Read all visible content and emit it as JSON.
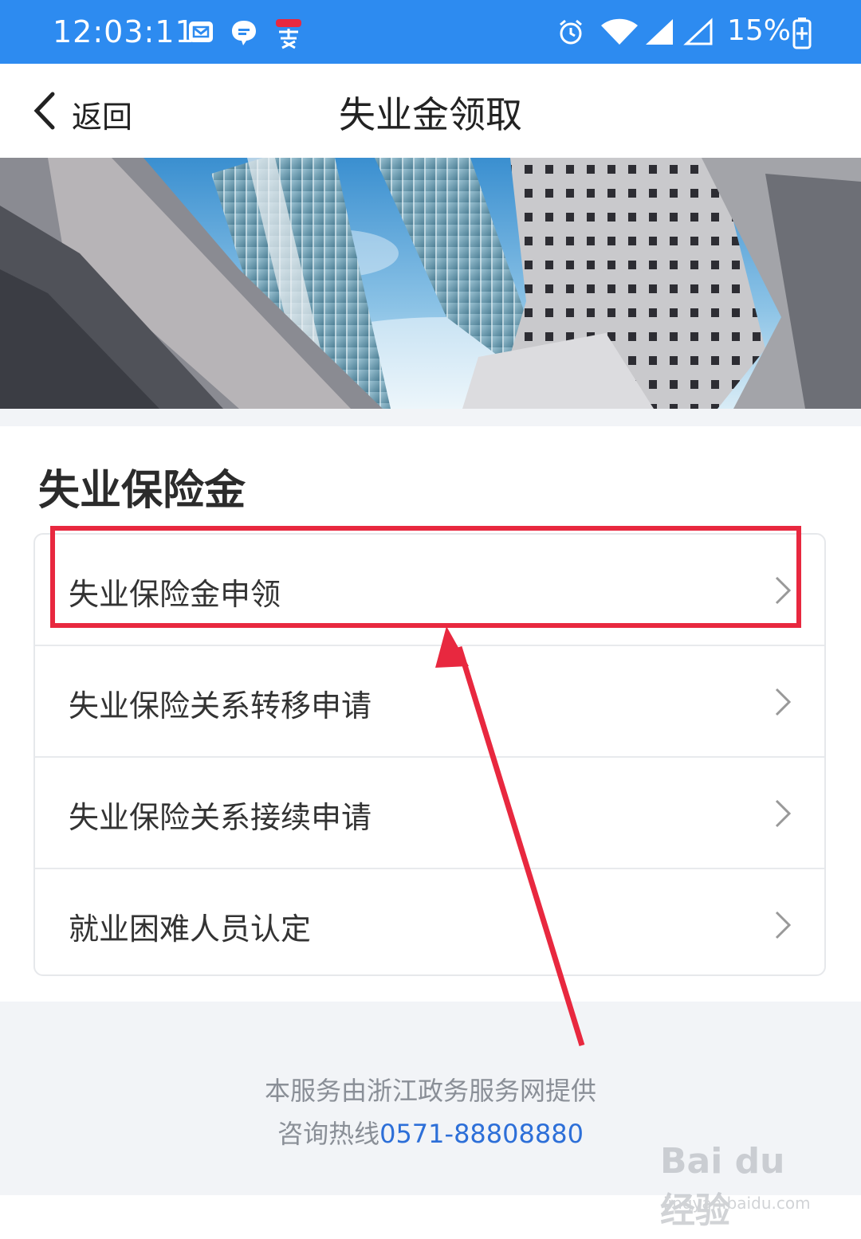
{
  "status_bar": {
    "time": "12:03:11",
    "battery": "15%",
    "left_icons": [
      "mail-icon",
      "chat-bubble-icon",
      "app-badge-icon"
    ],
    "right_icons": [
      "alarm-icon",
      "wifi-icon",
      "signal-icon",
      "signal-empty-icon",
      "battery-charging-icon"
    ],
    "background_color": "#2d8bf0"
  },
  "nav": {
    "back_label": "返回",
    "title": "失业金领取"
  },
  "section": {
    "title": "失业保险金",
    "items": [
      {
        "label": "失业保险金申领"
      },
      {
        "label": "失业保险关系转移申请"
      },
      {
        "label": "失业保险关系接续申请"
      },
      {
        "label": "就业困难人员认定"
      }
    ]
  },
  "footer": {
    "provider": "本服务由浙江政务服务网提供",
    "hotline_label": "咨询热线",
    "hotline_number": "0571-88808880"
  },
  "annotation": {
    "highlight_color": "#e8283f"
  },
  "watermark": {
    "text": "Bai du 经验",
    "sub": "jingyan.baidu.com"
  }
}
